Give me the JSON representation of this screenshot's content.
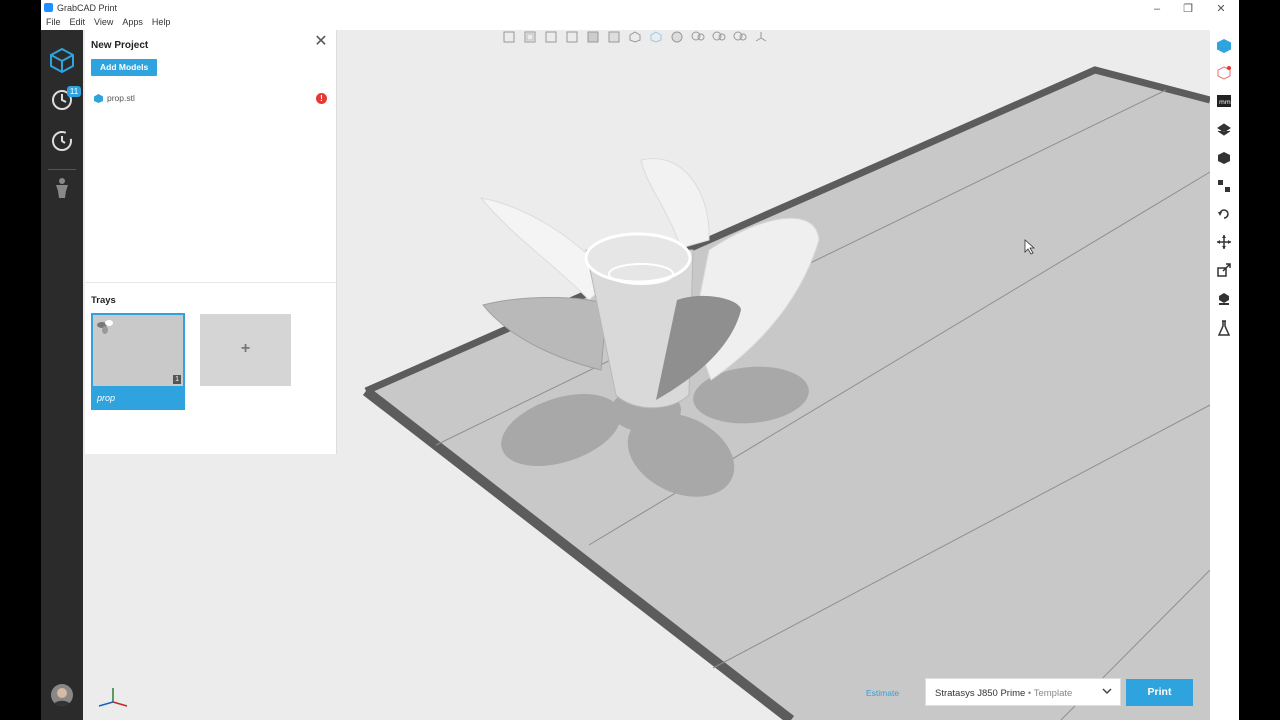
{
  "window": {
    "title": "GrabCAD Print",
    "controls": {
      "minimize": "–",
      "restore": "❐",
      "close": "✕"
    }
  },
  "menu": [
    "File",
    "Edit",
    "View",
    "Apps",
    "Help"
  ],
  "nav": {
    "queue_badge": "11"
  },
  "panel": {
    "title": "New Project",
    "close_glyph": "✕",
    "add_models": "Add Models",
    "models": [
      {
        "name": "prop.stl",
        "warning": "!"
      }
    ],
    "trays_label": "Trays",
    "trays": [
      {
        "name": "prop",
        "count": "1"
      }
    ],
    "add_tray": "+"
  },
  "bottom": {
    "estimate": "Estimate",
    "printer": "Stratasys J850 Prime",
    "template": "Template",
    "print": "Print"
  },
  "colors": {
    "accent": "#2ea3dd",
    "nav": "#2b2b2b",
    "tray": "#c8c8c8",
    "warning": "#e53935"
  }
}
